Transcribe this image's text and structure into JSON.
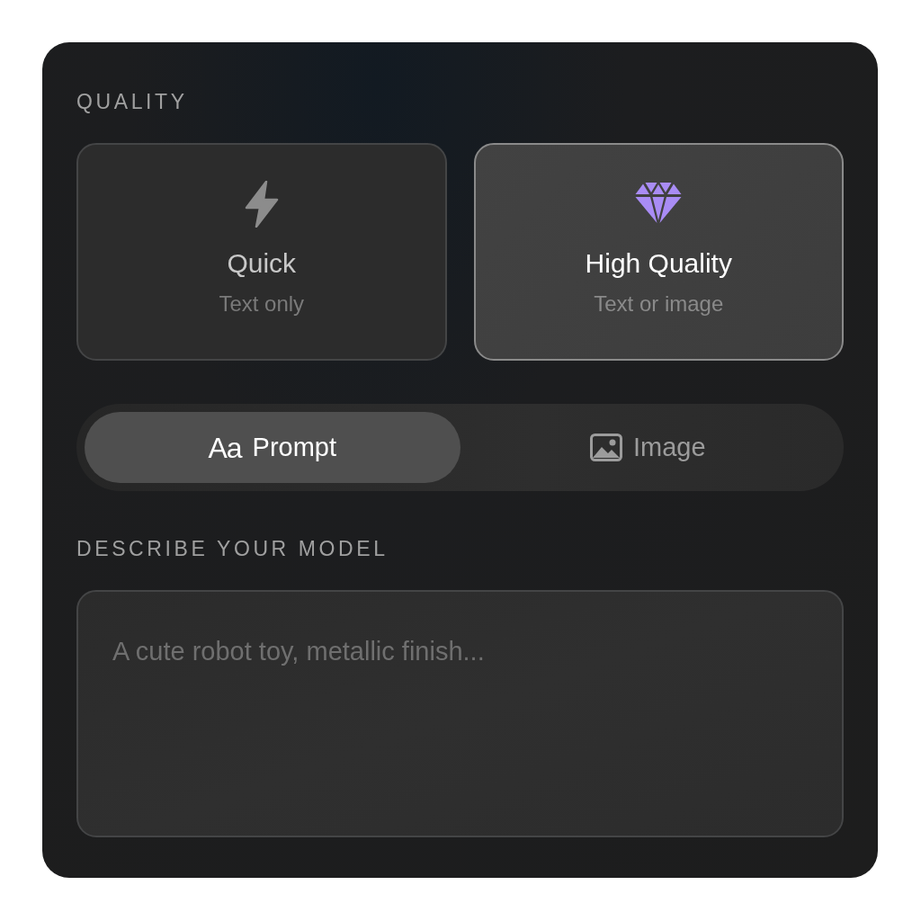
{
  "quality": {
    "label": "QUALITY",
    "options": [
      {
        "kind": "bolt",
        "title": "Quick",
        "subtitle": "Text only",
        "selected": false
      },
      {
        "kind": "diamond",
        "title": "High Quality",
        "subtitle": "Text or image",
        "selected": true
      }
    ]
  },
  "input_mode": {
    "segments": [
      {
        "kind": "text",
        "glyph": "Aa",
        "label": "Prompt",
        "selected": true
      },
      {
        "kind": "image",
        "label": "Image",
        "selected": false
      }
    ]
  },
  "description": {
    "label": "DESCRIBE YOUR MODEL",
    "placeholder": "A cute robot toy, metallic finish..."
  }
}
